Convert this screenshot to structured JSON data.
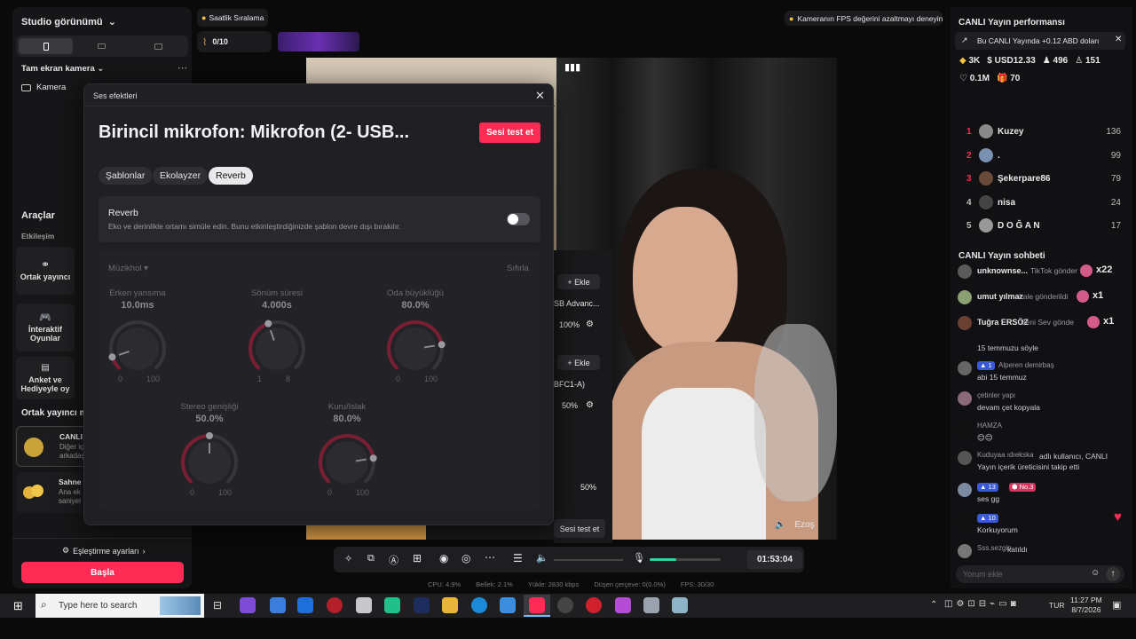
{
  "left": {
    "studio_label": "Studio görünümü",
    "camera_section": "Tam ekran kamera",
    "camera_item": "Kamera",
    "tools_title": "Araçlar",
    "interaction_label": "Etkileşim",
    "tiles": [
      "Ortak yayıncı",
      "İnteraktif Oyunlar",
      "Anket ve Hediyeyle oy"
    ],
    "cohost_title": "Ortak yayıncı m",
    "cohost_card1_title": "CANLI",
    "cohost_card1_line1": "Diğer iç",
    "cohost_card1_line2": "arkadaş",
    "cohost_card2_title": "Sahne",
    "cohost_card2_line1": "Ana ek",
    "cohost_card2_line2": "saniyel",
    "matching_settings": "Eşleştirme ayarları",
    "start_button": "Başla"
  },
  "topbar": {
    "hourly_ranking": "Saatlik Sıralama",
    "counter": "0/10",
    "fps_tip": "Kameranın FPS değerini azaltmayı deneyin"
  },
  "modal": {
    "header": "Ses efektleri",
    "title": "Birincil mikrofon: Mikrofon (2- USB...",
    "test_button": "Sesi test et",
    "tabs": [
      "Şablonlar",
      "Ekolayzer",
      "Reverb"
    ],
    "active_tab": "Reverb",
    "reverb_title": "Reverb",
    "reverb_desc": "Eko ve derinlikle ortamı simüle edin. Bunu etkinleştirdiğinizde şablon devre dışı bırakılır.",
    "preset": "Müzikhol",
    "reset": "Sıfırla",
    "knobs": [
      {
        "label": "Erken yansıma",
        "value": "10.0ms",
        "min": "0",
        "max": "100",
        "fraction": 0.1
      },
      {
        "label": "Sönüm süresi",
        "value": "4.000s",
        "min": "1",
        "max": "8",
        "fraction": 0.43
      },
      {
        "label": "Oda büyüklüğü",
        "value": "80.0%",
        "min": "0",
        "max": "100",
        "fraction": 0.8
      },
      {
        "label": "Stereo genişliği",
        "value": "50.0%",
        "min": "0",
        "max": "100",
        "fraction": 0.5
      },
      {
        "label": "Kuru/Islak",
        "value": "80.0%",
        "min": "0",
        "max": "100",
        "fraction": 0.8
      }
    ]
  },
  "behind": {
    "add1": "+ Ekle",
    "device1": "SB Advanc...",
    "vol1": "100%",
    "add2": "+ Ekle",
    "device2": "BFC1-A)",
    "vol2": "50%",
    "vol3": "50%",
    "test_button": "Sesi test et"
  },
  "video": {
    "gift_name": "Ezoş"
  },
  "controls": {
    "timer": "01:53:04",
    "stats": [
      "CPU: 4.9%",
      "Bellek: 2.1%",
      "Yükle: 2830 kbps",
      "Düşen çerçeve: 0(0.0%)",
      "FPS: 30/30"
    ],
    "mic_level": 0.38
  },
  "right": {
    "perf_title": "CANLI Yayın performansı",
    "perf_banner": "Bu CANLI Yayında +0.12 ABD doları",
    "stats": [
      "3K",
      "USD12.33",
      "496",
      "151",
      "0.1M",
      "70"
    ],
    "ranking": [
      {
        "rank": "1",
        "name": "Kuzey",
        "score": "136"
      },
      {
        "rank": "2",
        "name": ".",
        "score": "99"
      },
      {
        "rank": "3",
        "name": "Şekerpare86",
        "score": "79"
      },
      {
        "rank": "4",
        "name": "nisa",
        "score": "24"
      },
      {
        "rank": "5",
        "name": "D O Ğ A N",
        "score": "17"
      }
    ],
    "chat_title": "CANLI Yayın sohbeti",
    "pinned": [
      {
        "user": "unknownse...",
        "text": "TikTok gönder",
        "count": "x22"
      },
      {
        "user": "umut yılmaz",
        "text": "Lale gönderildi",
        "count": "x1"
      },
      {
        "user": "Tuğra ERSÖZ",
        "text": "Beni Sev gönde",
        "count": "x1"
      }
    ],
    "chat": [
      {
        "user": "",
        "text": "15 temmuzu söyle"
      },
      {
        "user": "Alperen demirbaş",
        "badge": "1",
        "text": "abi 15 temmuz"
      },
      {
        "user": "çetinler yapı",
        "text": "devam çet kopyala"
      },
      {
        "user": "HAMZA",
        "text": "😊😊"
      },
      {
        "user": "Kuduyaa ıdıekska",
        "text": "adlı kullanıcı, CANLI Yayın içerik üreticisini takip etti"
      },
      {
        "user": "",
        "badge": "13",
        "badge2": "No.3",
        "text": "ses gg"
      },
      {
        "user": "",
        "badge": "10",
        "text": "Korkuyorum"
      },
      {
        "user": "Sss.sezgin",
        "text": "katıldı"
      }
    ],
    "comment_placeholder": "Yorum ekle"
  },
  "taskbar": {
    "search_placeholder": "Type here to search",
    "lang": "TUR",
    "time": "11:27 PM",
    "date": "8/7/2026"
  }
}
